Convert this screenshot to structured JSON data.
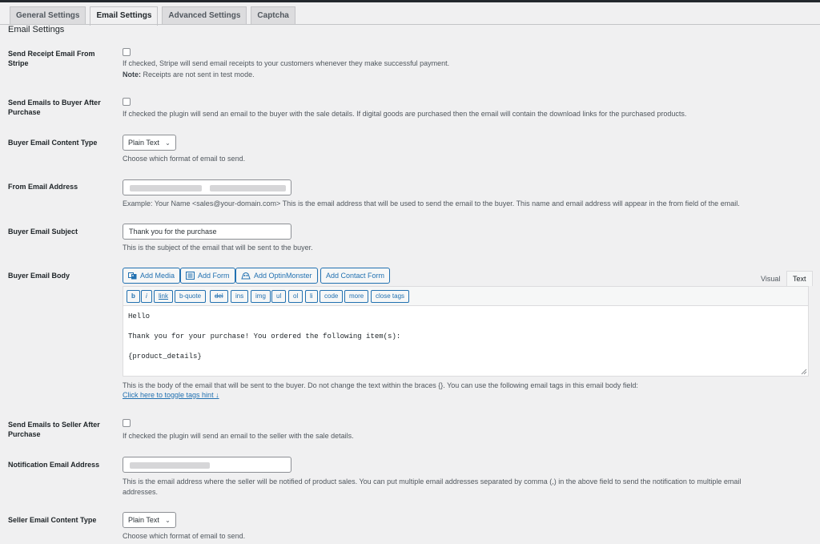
{
  "tabs": [
    {
      "label": "General Settings",
      "active": false
    },
    {
      "label": "Email Settings",
      "active": true
    },
    {
      "label": "Advanced Settings",
      "active": false
    },
    {
      "label": "Captcha",
      "active": false
    }
  ],
  "page_title": "Email Settings",
  "receipt": {
    "label": "Send Receipt Email From Stripe",
    "checked": false,
    "desc": "If checked, Stripe will send email receipts to your customers whenever they make successful payment.",
    "note_label": "Note:",
    "note_text": " Receipts are not sent in test mode."
  },
  "buyer_email": {
    "label": "Send Emails to Buyer After Purchase",
    "checked": false,
    "desc": "If checked the plugin will send an email to the buyer with the sale details. If digital goods are purchased then the email will contain the download links for the purchased products."
  },
  "buyer_content_type": {
    "label": "Buyer Email Content Type",
    "value": "Plain Text",
    "desc": "Choose which format of email to send."
  },
  "from_email": {
    "label": "From Email Address",
    "desc": "Example: Your Name <sales@your-domain.com> This is the email address that will be used to send the email to the buyer. This name and email address will appear in the from field of the email."
  },
  "buyer_subject": {
    "label": "Buyer Email Subject",
    "value": "Thank you for the purchase",
    "desc": "This is the subject of the email that will be sent to the buyer."
  },
  "buyer_body": {
    "label": "Buyer Email Body",
    "media_buttons": [
      "Add Media",
      "Add Form",
      "Add OptinMonster",
      "Add Contact Form"
    ],
    "editor_tabs": [
      "Visual",
      "Text"
    ],
    "quicktags": [
      "b",
      "i",
      "link",
      "b-quote",
      "del",
      "ins",
      "img",
      "ul",
      "ol",
      "li",
      "code",
      "more",
      "close tags"
    ],
    "content_lines": [
      "Hello",
      "",
      "Thank you for your purchase! You ordered the following item(s):",
      "",
      "{product_details}"
    ],
    "desc": "This is the body of the email that will be sent to the buyer. Do not change the text within the braces {}. You can use the following email tags in this email body field:",
    "toggle_link": "Click here to toggle tags hint ↓"
  },
  "seller_email": {
    "label": "Send Emails to Seller After Purchase",
    "checked": false,
    "desc": "If checked the plugin will send an email to the seller with the sale details."
  },
  "notification_email": {
    "label": "Notification Email Address",
    "desc_line1": "This is the email address where the seller will be notified of product sales. You can put multiple email addresses separated by comma (,) in the above field to send the notification to multiple email",
    "desc_line2": "addresses."
  },
  "seller_content_type": {
    "label": "Seller Email Content Type",
    "value": "Plain Text",
    "desc": "Choose which format of email to send."
  },
  "colors": {
    "link": "#2271b1",
    "background": "#f0f0f1"
  }
}
